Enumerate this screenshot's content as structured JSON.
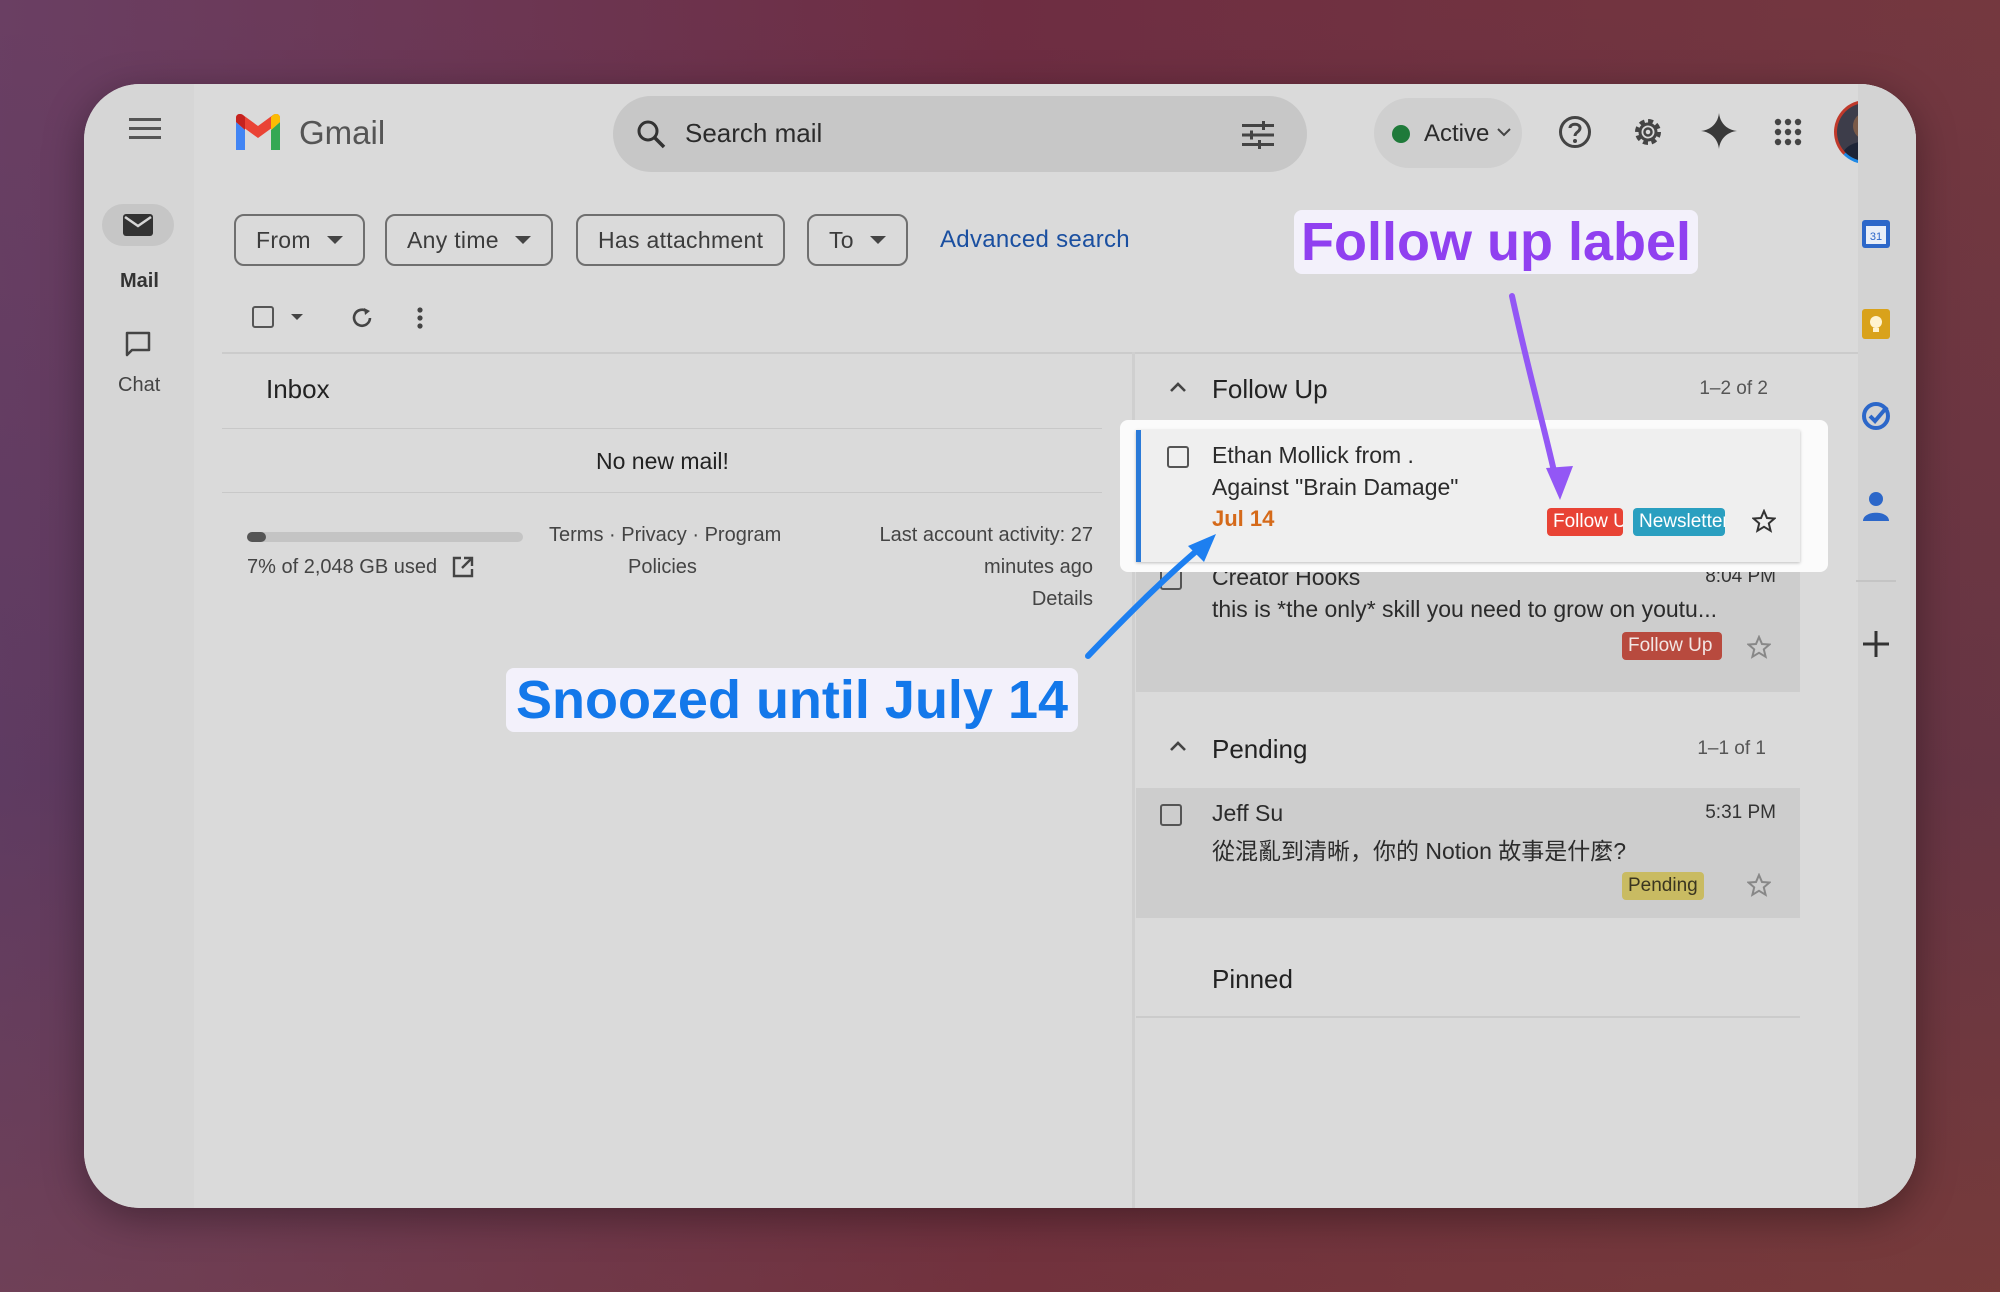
{
  "header": {
    "app_name": "Gmail",
    "search_placeholder": "Search mail",
    "status": "Active"
  },
  "nav": {
    "mail": "Mail",
    "chat": "Chat"
  },
  "filters": [
    "From",
    "Any time",
    "Has attachment",
    "To"
  ],
  "filters_link": "Advanced search",
  "inbox": {
    "title": "Inbox",
    "empty_message": "No new mail!"
  },
  "footer": {
    "storage_text": "7% of 2,048 GB used",
    "storage_fraction": 0.07,
    "terms": "Terms",
    "privacy": "Privacy",
    "program": "Program",
    "policies": "Policies",
    "sep": " · ",
    "activity_line1": "Last account activity: 27",
    "activity_line2": "minutes ago",
    "details": "Details"
  },
  "sections": {
    "followup": {
      "title": "Follow Up",
      "count": "1–2 of 2",
      "emails": [
        {
          "sender": "Ethan Mollick from .",
          "subject": "Against \"Brain Damage\"",
          "snooze_date": "Jul 14",
          "labels": [
            "Follow Up",
            "Newsletter"
          ]
        },
        {
          "sender": "Creator Hooks",
          "time": "8:04 PM",
          "subject": "this is *the only* skill you need to grow on youtu...",
          "labels": [
            "Follow Up"
          ]
        }
      ]
    },
    "pending": {
      "title": "Pending",
      "count": "1–1 of 1",
      "emails": [
        {
          "sender": "Jeff Su",
          "time": "5:31 PM",
          "subject": "從混亂到清晰，你的 Notion 故事是什麼?",
          "labels": [
            "Pending"
          ]
        }
      ]
    },
    "pinned": {
      "title": "Pinned"
    }
  },
  "annotations": {
    "follow_up": "Follow up label",
    "snoozed": "Snoozed until July 14"
  },
  "colors": {
    "follow_up_label": "#e84335",
    "newsletter_label": "#2a9fc0",
    "pending_label": "#c9bb62",
    "snooze_date": "#d56a1a",
    "follow_up_callout": "#9040f0",
    "snoozed_callout": "#1378ea"
  }
}
